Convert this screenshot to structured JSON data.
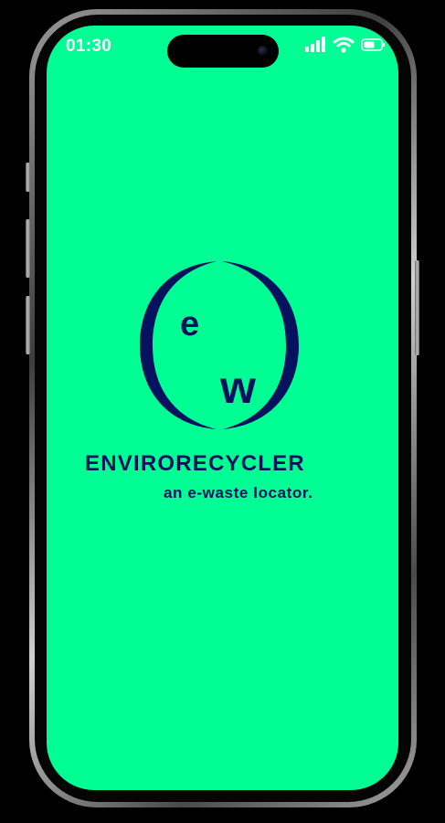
{
  "colors": {
    "screen_background": "#00fe94",
    "brand_navy": "#07125e",
    "status_text": "#ffffff"
  },
  "status_bar": {
    "time": "01:30",
    "icons": [
      "cellular-signal-icon",
      "wifi-icon",
      "battery-icon"
    ]
  },
  "splash": {
    "logo_letters": {
      "e": "e",
      "w": "w"
    },
    "app_name": "ENVIRORECYCLER",
    "tagline": "an e-waste locator."
  }
}
